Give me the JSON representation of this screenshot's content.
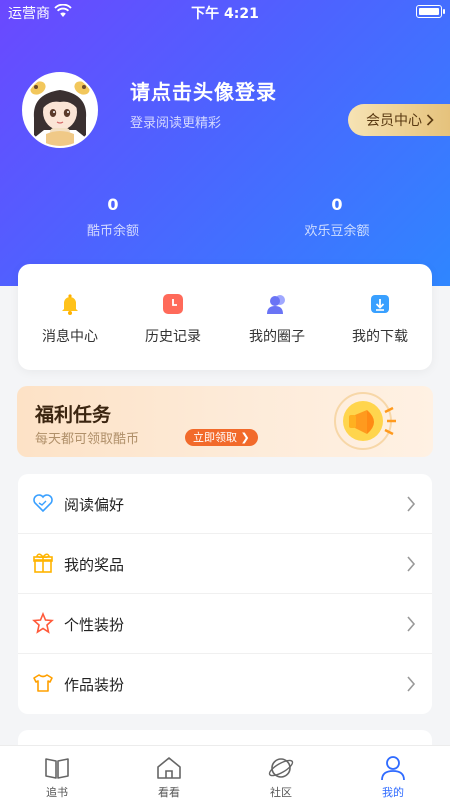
{
  "status_bar": {
    "carrier": "运营商",
    "time": "下午 4:21"
  },
  "profile": {
    "title": "请点击头像登录",
    "subtitle": "登录阅读更精彩",
    "vip_label": "会员中心",
    "avatar_icon": "anime-girl-avatar"
  },
  "balances": [
    {
      "value": "0",
      "label": "酷币余额"
    },
    {
      "value": "0",
      "label": "欢乐豆余额"
    }
  ],
  "quick_actions": [
    {
      "label": "消息中心",
      "icon": "bell-icon"
    },
    {
      "label": "历史记录",
      "icon": "history-clock-icon"
    },
    {
      "label": "我的圈子",
      "icon": "people-icon"
    },
    {
      "label": "我的下载",
      "icon": "download-icon"
    }
  ],
  "welfare": {
    "title": "福利任务",
    "subtitle": "每天都可领取酷币",
    "button": "立即领取"
  },
  "menu": [
    {
      "label": "阅读偏好",
      "icon": "heart-icon"
    },
    {
      "label": "我的奖品",
      "icon": "gift-icon"
    },
    {
      "label": "个性装扮",
      "icon": "star-icon"
    },
    {
      "label": "作品装扮",
      "icon": "shirt-icon"
    }
  ],
  "tabs": [
    {
      "label": "追书",
      "icon": "book-icon",
      "active": false
    },
    {
      "label": "看看",
      "icon": "home-icon",
      "active": false
    },
    {
      "label": "社区",
      "icon": "planet-icon",
      "active": false
    },
    {
      "label": "我的",
      "icon": "user-icon",
      "active": true
    }
  ],
  "colors": {
    "primary": "#2f6bff",
    "hero_start": "#6b48ff",
    "hero_end": "#2f86ff",
    "vip_gold": "#e5c27c",
    "welfare_button": "#f26a2b"
  }
}
